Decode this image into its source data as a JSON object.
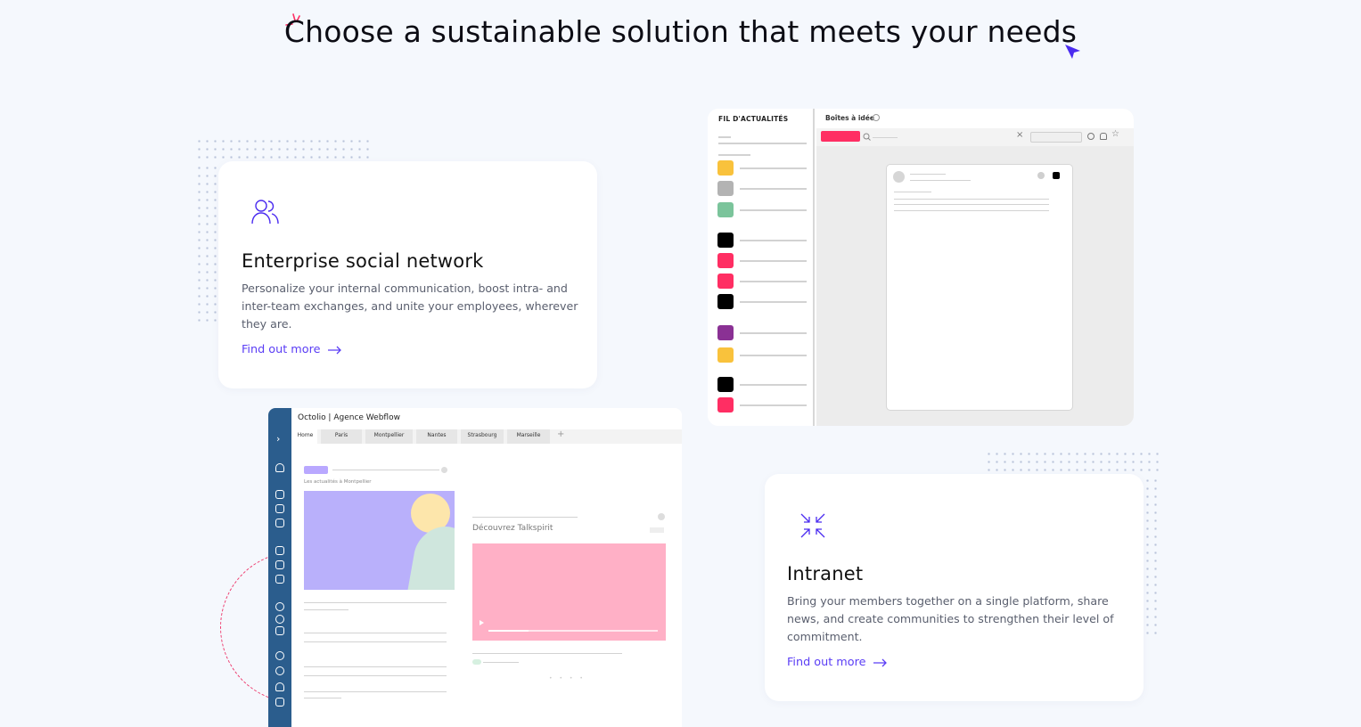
{
  "headline": "Choose a sustainable solution that meets your needs",
  "colors": {
    "accent": "#5a3df5",
    "pink": "#ff2e63",
    "rail": "#2b5d8d"
  },
  "cards": [
    {
      "icon": "users-icon",
      "title": "Enterprise social network",
      "description": "Personalize your internal communication, boost intra- and inter-team exchanges, and unite your employees, wherever they are.",
      "link": "Find out more"
    },
    {
      "icon": "arrows-inward-icon",
      "title": "Intranet",
      "description": "Bring your members together on a single platform, share news, and create communities to strengthen their level of commitment.",
      "link": "Find out more"
    }
  ],
  "feed_mockup": {
    "sidebar_title": "FIL D'ACTUALITÉS",
    "topbar_title": "Boîtes à idée",
    "category_colors": [
      "#f9c23c",
      "#b3b3b3",
      "#7bc49b",
      "#000000",
      "#ff2e63",
      "#ff2e63",
      "#000000",
      "#8a3194",
      "#f9c23c",
      "#000000",
      "#ff2e63"
    ]
  },
  "webflow_mockup": {
    "title": "Octolio | Agence Webflow",
    "tabs": [
      "Home",
      "Paris",
      "Montpellier",
      "Nantes",
      "Strasbourg",
      "Marseille"
    ],
    "news_caption": "Les actualités à Montpellier",
    "discover_title": "Découvrez Talkspirit"
  }
}
